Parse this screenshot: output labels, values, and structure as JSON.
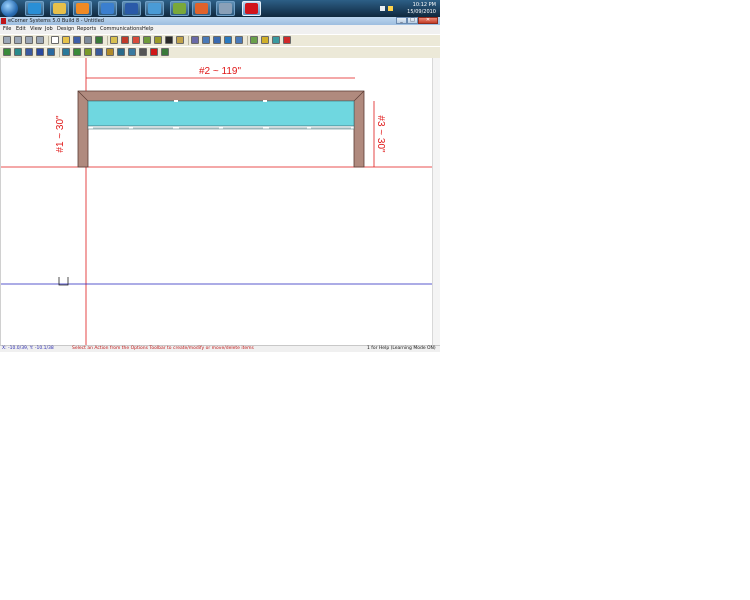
{
  "taskbar": {
    "apps": [
      {
        "name": "start-orb-icon"
      },
      {
        "name": "internet-explorer-icon",
        "color": "#2a8fd6"
      },
      {
        "name": "folder-icon",
        "color": "#e8c04a"
      },
      {
        "name": "media-player-icon",
        "color": "#f08a24"
      },
      {
        "name": "paint-icon",
        "color": "#3b7fcf"
      },
      {
        "name": "word-icon",
        "color": "#2a5aa8"
      },
      {
        "name": "network-icon",
        "color": "#4a9bd6"
      },
      {
        "name": "calculator-icon",
        "color": "#7aa83a"
      },
      {
        "name": "stamp-app-icon",
        "color": "#e0622b"
      },
      {
        "name": "tools-app-icon",
        "color": "#8aa0b8"
      },
      {
        "name": "ecorner-app-icon",
        "color": "#d1141c"
      }
    ],
    "time": "10:12 PM",
    "date": "15/09/2010"
  },
  "window": {
    "title": "eCorner Systems 5.0 Build 8 - Untitled",
    "minimize_label": "_",
    "maximize_label": "□",
    "close_label": "✕"
  },
  "menu": [
    "File",
    "Edit",
    "View",
    "Job",
    "Design",
    "Reports",
    "Communications",
    "Help"
  ],
  "drawing": {
    "dim_top": "#2 ~ 119\"",
    "dim_left": "#1 ~ 30\"",
    "dim_right": "#3 ~ 30\"",
    "colors": {
      "frame": "#b08a7e",
      "glass": "#6fd7e0",
      "dim_line": "#e01818",
      "guide_line": "#2222bb"
    }
  },
  "status": {
    "coords": "X: -10.0/39, Y: -10.1/38",
    "message": "Select an Action from the Options Toolbar to create/modify or move/delete items",
    "help": "1 for Help (Learning Mode ON)"
  }
}
